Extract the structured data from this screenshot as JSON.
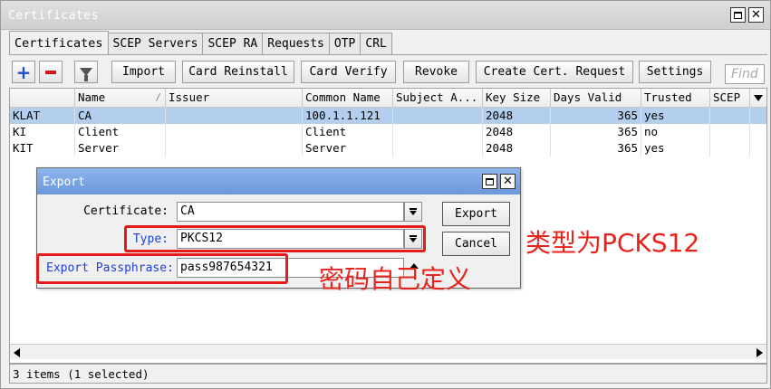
{
  "window": {
    "title": "Certificates"
  },
  "tabs": [
    {
      "label": "Certificates",
      "active": true
    },
    {
      "label": "SCEP Servers"
    },
    {
      "label": "SCEP RA"
    },
    {
      "label": "Requests"
    },
    {
      "label": "OTP"
    },
    {
      "label": "CRL"
    }
  ],
  "toolbar": {
    "add_icon": "plus-icon",
    "remove_icon": "minus-icon",
    "filter_icon": "funnel-icon",
    "import": "Import",
    "card_reinstall": "Card Reinstall",
    "card_verify": "Card Verify",
    "revoke": "Revoke",
    "create_request": "Create Cert. Request",
    "settings": "Settings",
    "find_placeholder": "Find"
  },
  "table": {
    "columns": [
      "",
      "Name",
      "Issuer",
      "Common Name",
      "Subject A...",
      "Key Size",
      "Days Valid",
      "Trusted",
      "SCEP"
    ],
    "rows": [
      {
        "flags": "KLAT",
        "name": "CA",
        "issuer": "",
        "common_name": "100.1.1.121",
        "subject_alt": "",
        "key_size": "2048",
        "days_valid": "365",
        "trusted": "yes",
        "scep": "",
        "selected": true
      },
      {
        "flags": "KI",
        "name": "Client",
        "issuer": "",
        "common_name": "Client",
        "subject_alt": "",
        "key_size": "2048",
        "days_valid": "365",
        "trusted": "no",
        "scep": ""
      },
      {
        "flags": "KIT",
        "name": "Server",
        "issuer": "",
        "common_name": "Server",
        "subject_alt": "",
        "key_size": "2048",
        "days_valid": "365",
        "trusted": "yes",
        "scep": ""
      }
    ]
  },
  "status": {
    "text": "3 items (1 selected)"
  },
  "export_dialog": {
    "title": "Export",
    "certificate_label": "Certificate:",
    "certificate_value": "CA",
    "type_label": "Type:",
    "type_value": "PKCS12",
    "passphrase_label": "Export Passphrase:",
    "passphrase_value": "pass987654321",
    "export_button": "Export",
    "cancel_button": "Cancel"
  },
  "annotations": {
    "type_note": "类型为PCKS12",
    "passphrase_note": "密码自己定义",
    "color": "#e8231c"
  }
}
